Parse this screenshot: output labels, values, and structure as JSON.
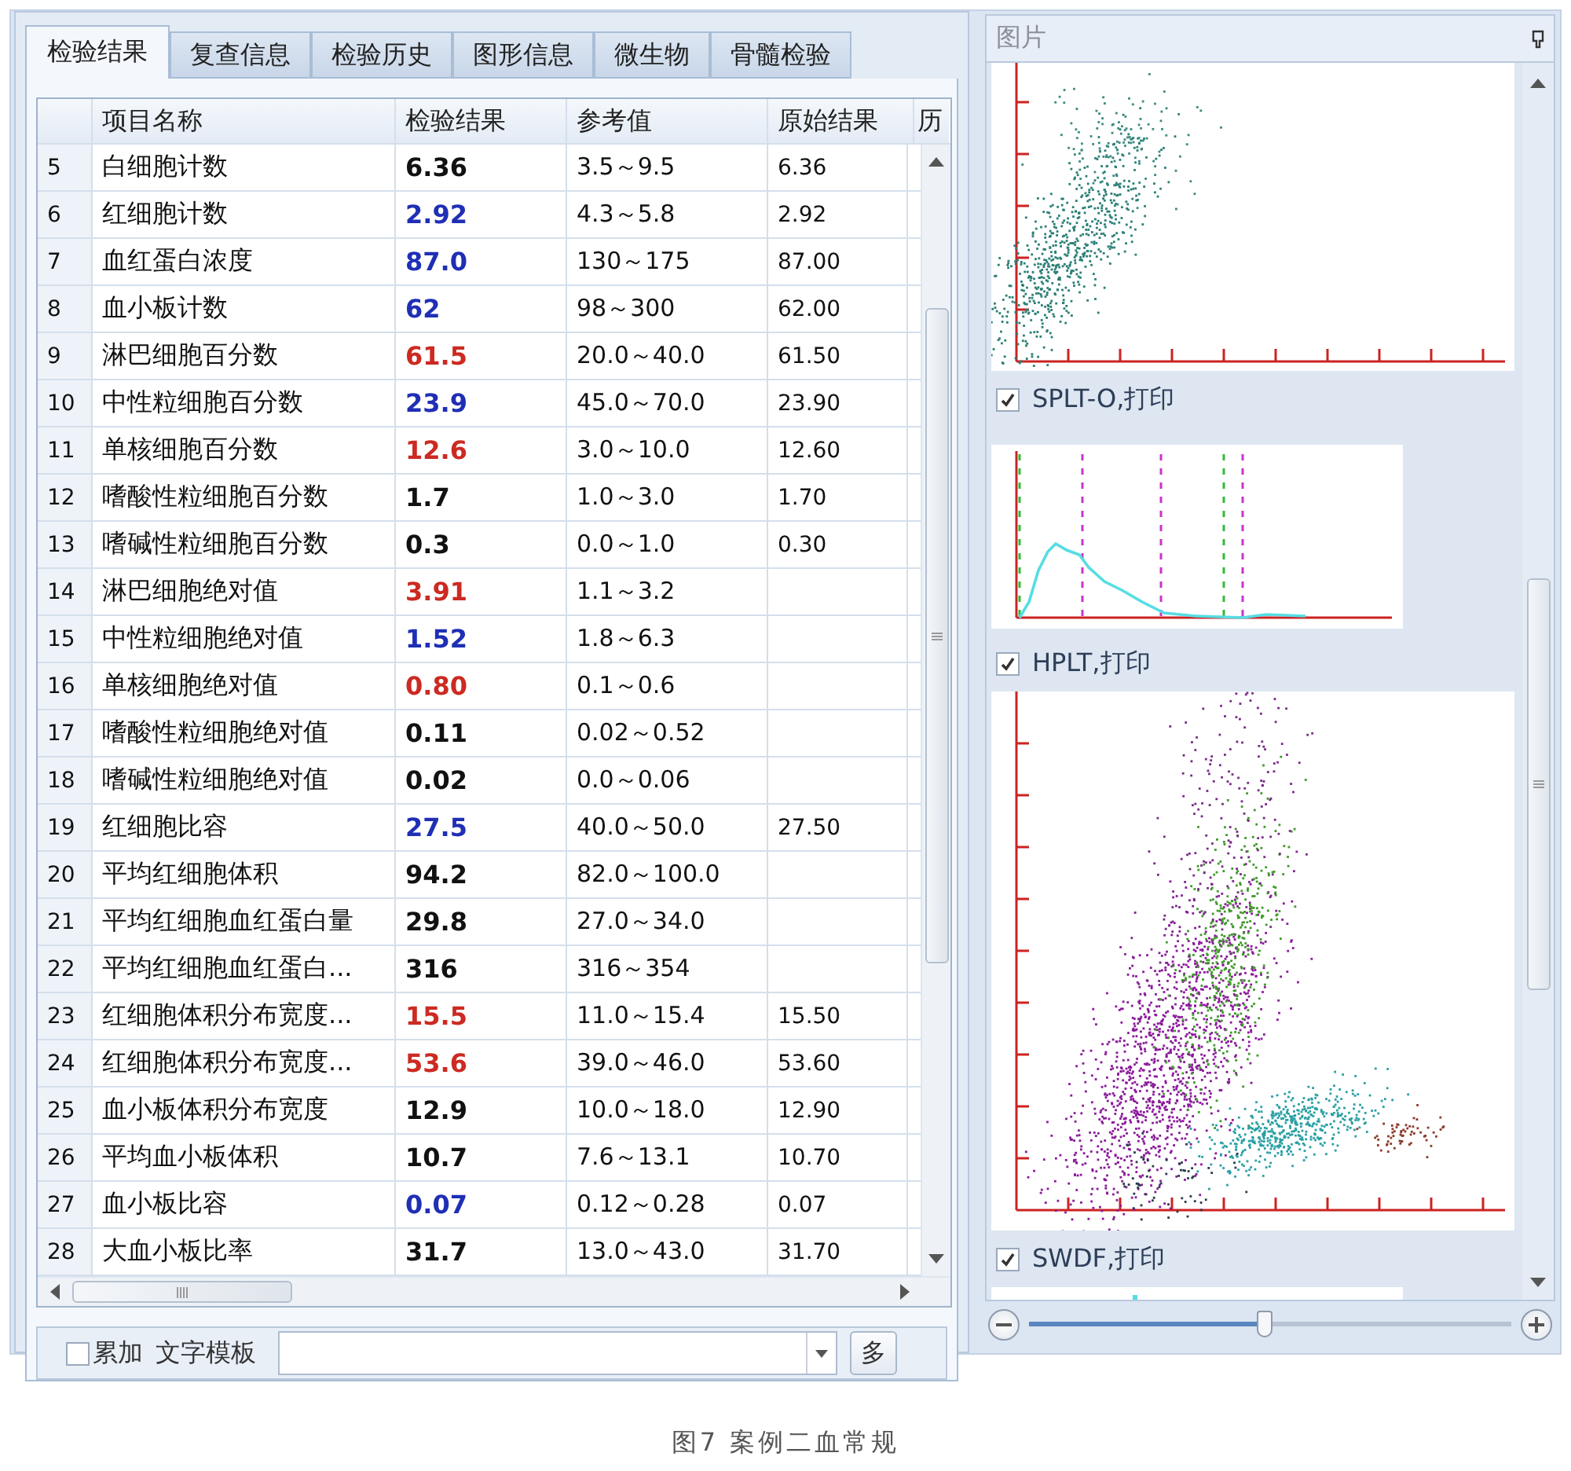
{
  "tabs": [
    {
      "label": "检验结果",
      "selected": true
    },
    {
      "label": "复查信息",
      "selected": false
    },
    {
      "label": "检验历史",
      "selected": false
    },
    {
      "label": "图形信息",
      "selected": false
    },
    {
      "label": "微生物",
      "selected": false
    },
    {
      "label": "骨髓检验",
      "selected": false
    }
  ],
  "table": {
    "columns": [
      "项目名称",
      "检验结果",
      "参考值",
      "原始结果",
      "历"
    ],
    "rows": [
      {
        "no": "5",
        "name": "白细胞计数",
        "result": "6.36",
        "color": "#111111",
        "reference": "3.5～9.5",
        "raw": "6.36"
      },
      {
        "no": "6",
        "name": "红细胞计数",
        "result": "2.92",
        "color": "#1f2fb5",
        "reference": "4.3～5.8",
        "raw": "2.92"
      },
      {
        "no": "7",
        "name": "血红蛋白浓度",
        "result": "87.0",
        "color": "#1f2fb5",
        "reference": "130～175",
        "raw": "87.00"
      },
      {
        "no": "8",
        "name": "血小板计数",
        "result": "62",
        "color": "#1f2fb5",
        "reference": "98～300",
        "raw": "62.00"
      },
      {
        "no": "9",
        "name": "淋巴细胞百分数",
        "result": "61.5",
        "color": "#cc2a22",
        "reference": "20.0～40.0",
        "raw": "61.50"
      },
      {
        "no": "10",
        "name": "中性粒细胞百分数",
        "result": "23.9",
        "color": "#1f2fb5",
        "reference": "45.0～70.0",
        "raw": "23.90"
      },
      {
        "no": "11",
        "name": "单核细胞百分数",
        "result": "12.6",
        "color": "#cc2a22",
        "reference": "3.0～10.0",
        "raw": "12.60"
      },
      {
        "no": "12",
        "name": "嗜酸性粒细胞百分数",
        "result": "1.7",
        "color": "#111111",
        "reference": "1.0～3.0",
        "raw": "1.70"
      },
      {
        "no": "13",
        "name": "嗜碱性粒细胞百分数",
        "result": "0.3",
        "color": "#111111",
        "reference": "0.0～1.0",
        "raw": "0.30"
      },
      {
        "no": "14",
        "name": "淋巴细胞绝对值",
        "result": "3.91",
        "color": "#cc2a22",
        "reference": "1.1～3.2"
      },
      {
        "no": "15",
        "name": "中性粒细胞绝对值",
        "result": "1.52",
        "color": "#1f2fb5",
        "reference": "1.8～6.3"
      },
      {
        "no": "16",
        "name": "单核细胞绝对值",
        "result": "0.80",
        "color": "#cc2a22",
        "reference": "0.1～0.6"
      },
      {
        "no": "17",
        "name": "嗜酸性粒细胞绝对值",
        "result": "0.11",
        "color": "#111111",
        "reference": "0.02～0.52"
      },
      {
        "no": "18",
        "name": "嗜碱性粒细胞绝对值",
        "result": "0.02",
        "color": "#111111",
        "reference": "0.0～0.06"
      },
      {
        "no": "19",
        "name": "红细胞比容",
        "result": "27.5",
        "color": "#1f2fb5",
        "reference": "40.0～50.0",
        "raw": "27.50"
      },
      {
        "no": "20",
        "name": "平均红细胞体积",
        "result": "94.2",
        "color": "#111111",
        "reference": "82.0～100.0"
      },
      {
        "no": "21",
        "name": "平均红细胞血红蛋白量",
        "result": "29.8",
        "color": "#111111",
        "reference": "27.0～34.0"
      },
      {
        "no": "22",
        "name": "平均红细胞血红蛋白...",
        "result": "316",
        "color": "#111111",
        "reference": "316～354"
      },
      {
        "no": "23",
        "name": "红细胞体积分布宽度...",
        "result": "15.5",
        "color": "#cc2a22",
        "reference": "11.0～15.4",
        "raw": "15.50"
      },
      {
        "no": "24",
        "name": "红细胞体积分布宽度...",
        "result": "53.6",
        "color": "#cc2a22",
        "reference": "39.0～46.0",
        "raw": "53.60"
      },
      {
        "no": "25",
        "name": "血小板体积分布宽度",
        "result": "12.9",
        "color": "#111111",
        "reference": "10.0～18.0",
        "raw": "12.90"
      },
      {
        "no": "26",
        "name": "平均血小板体积",
        "result": "10.7",
        "color": "#111111",
        "reference": "7.6～13.1",
        "raw": "10.70"
      },
      {
        "no": "27",
        "name": "血小板比容",
        "result": "0.07",
        "color": "#1f2fb5",
        "reference": "0.12～0.28",
        "raw": "0.07"
      },
      {
        "no": "28",
        "name": "大血小板比率",
        "result": "31.7",
        "color": "#111111",
        "reference": "13.0～43.0",
        "raw": "31.70"
      }
    ]
  },
  "bottom_bar": {
    "accumulate": {
      "label": "累加",
      "checked": false
    },
    "template_label": "文字模板",
    "button": "多"
  },
  "image_panel": {
    "title": "图片",
    "sections": [
      {
        "kind": "scatter"
      },
      {
        "kind": "label",
        "label": "SPLT-O,打印",
        "checked": true
      },
      {
        "kind": "histogram"
      },
      {
        "kind": "label",
        "label": "HPLT,打印",
        "checked": true
      },
      {
        "kind": "scatter"
      },
      {
        "kind": "label",
        "label": "SWDF,打印",
        "checked": true
      },
      {
        "kind": "strip"
      }
    ],
    "zoom": {
      "level": 0.49
    }
  },
  "caption": "图7 案例二血常规"
}
